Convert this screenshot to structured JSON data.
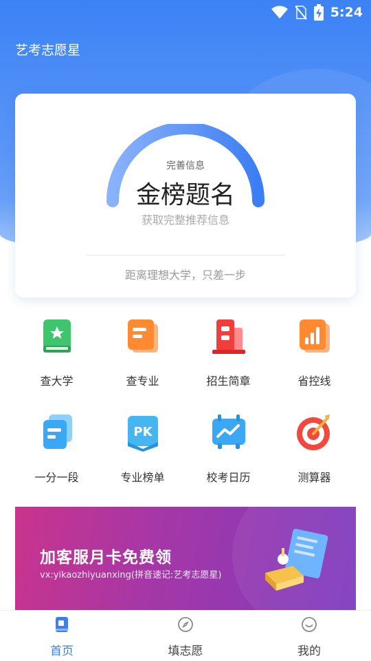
{
  "status_bar": {
    "time": "5:24",
    "icons": [
      "wifi-icon",
      "no-sim-icon",
      "battery-charging-icon"
    ]
  },
  "app": {
    "title": "艺考志愿星"
  },
  "hero_card": {
    "gauge_subtitle": "完善信息",
    "gauge_title": "金榜题名",
    "gauge_hint": "获取完整推荐信息",
    "footer": "距离理想大学，只差一步"
  },
  "grid": {
    "items": [
      {
        "label": "查大学",
        "icon": "book-star-icon",
        "color": "#3fc56d"
      },
      {
        "label": "查专业",
        "icon": "document-icon",
        "color": "#ff8a30"
      },
      {
        "label": "招生简章",
        "icon": "building-icon",
        "color": "#f23d3d"
      },
      {
        "label": "省控线",
        "icon": "bar-chart-icon",
        "color": "#ff8a30"
      },
      {
        "label": "一分一段",
        "icon": "stacked-cards-icon",
        "color": "#3aa8f5"
      },
      {
        "label": "专业榜单",
        "icon": "pk-icon",
        "color": "#45b6f2"
      },
      {
        "label": "校考日历",
        "icon": "calendar-trend-icon",
        "color": "#3aa8f5"
      },
      {
        "label": "测算器",
        "icon": "target-icon",
        "color": "#f2483d"
      }
    ]
  },
  "banner": {
    "title": "加客服月卡免费领",
    "subtitle": "vx:yikaozhiyuanxing(拼音速记:艺考志愿星)"
  },
  "tabbar": {
    "items": [
      {
        "label": "首页",
        "icon": "home-book-icon",
        "active": true
      },
      {
        "label": "填志愿",
        "icon": "compass-icon",
        "active": false
      },
      {
        "label": "我的",
        "icon": "smile-icon",
        "active": false
      }
    ]
  },
  "colors": {
    "accent": "#3c7ef3",
    "hero_top": "#3c82f5"
  }
}
